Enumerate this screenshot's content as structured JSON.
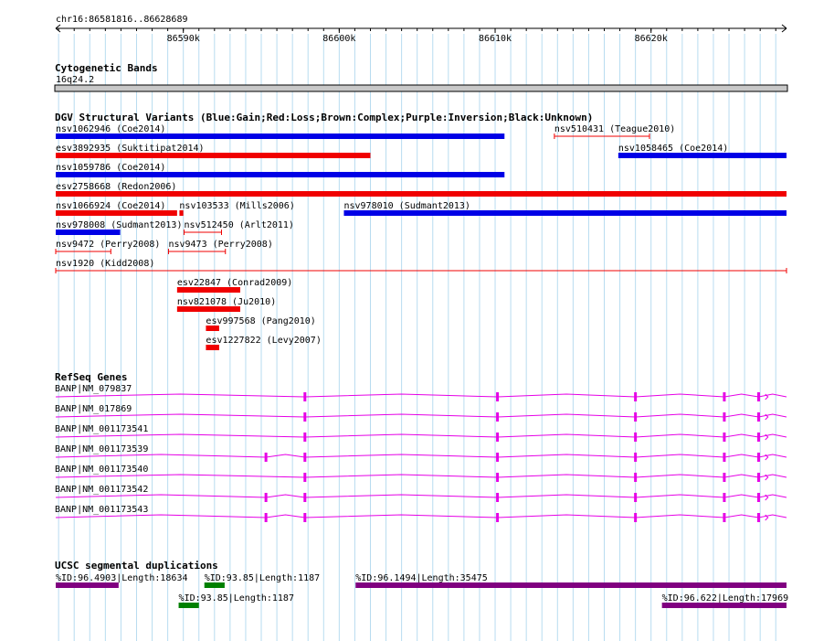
{
  "ruler": {
    "position": "chr16:86581816..86628689",
    "start": 86581816,
    "end": 86628689,
    "ticks": [
      {
        "bp": 86590000,
        "label": "86590k"
      },
      {
        "bp": 86600000,
        "label": "86600k"
      },
      {
        "bp": 86610000,
        "label": "86610k"
      },
      {
        "bp": 86620000,
        "label": "86620k"
      }
    ]
  },
  "cytoband": {
    "title": "Cytogenetic Bands",
    "band": "16q24.2",
    "color": "#c8c8c8"
  },
  "dgv": {
    "title": "DGV Structural Variants (Blue:Gain;Red:Loss;Brown:Complex;Purple:Inversion;Black:Unknown)",
    "colors": {
      "gain": "#0000e6",
      "loss": "#f00000"
    },
    "features": [
      {
        "name": "nsv1062946 (Coe2014)",
        "type": "gain",
        "style": "thick",
        "start": 86581816,
        "end": 86610600,
        "row": 0
      },
      {
        "name": "nsv510431 (Teague2010)",
        "type": "loss",
        "style": "thin",
        "start": 86613800,
        "end": 86619900,
        "row": 0
      },
      {
        "name": "esv3892935 (Suktitipat2014)",
        "type": "loss",
        "style": "thick",
        "start": 86581816,
        "end": 86602000,
        "row": 1
      },
      {
        "name": "nsv1058465 (Coe2014)",
        "type": "gain",
        "style": "thick",
        "start": 86617900,
        "end": 86628689,
        "row": 1
      },
      {
        "name": "nsv1059786 (Coe2014)",
        "type": "gain",
        "style": "thick",
        "start": 86581816,
        "end": 86610600,
        "row": 2
      },
      {
        "name": "esv2758668 (Redon2006)",
        "type": "loss",
        "style": "thick",
        "start": 86581816,
        "end": 86628689,
        "row": 3
      },
      {
        "name": "nsv1066924 (Coe2014)",
        "type": "loss",
        "style": "thick",
        "start": 86581816,
        "end": 86589600,
        "row": 4
      },
      {
        "name": "nsv103533 (Mills2006)",
        "type": "loss",
        "style": "thick",
        "start": 86589750,
        "end": 86590000,
        "row": 4
      },
      {
        "name": "nsv978010 (Sudmant2013)",
        "type": "gain",
        "style": "thick",
        "start": 86600300,
        "end": 86628689,
        "row": 4
      },
      {
        "name": "nsv978008 (Sudmant2013)",
        "type": "gain",
        "style": "thick",
        "start": 86581816,
        "end": 86585950,
        "row": 5
      },
      {
        "name": "nsv512450 (Arlt2011)",
        "type": "loss",
        "style": "thin",
        "start": 86590050,
        "end": 86592450,
        "row": 5
      },
      {
        "name": "nsv9472 (Perry2008)",
        "type": "loss",
        "style": "thin",
        "start": 86581816,
        "end": 86585350,
        "row": 6
      },
      {
        "name": "nsv9473 (Perry2008)",
        "type": "loss",
        "style": "thin",
        "start": 86589050,
        "end": 86592700,
        "row": 6
      },
      {
        "name": "nsv1920 (Kidd2008)",
        "type": "loss",
        "style": "thin",
        "start": 86581816,
        "end": 86628689,
        "row": 7
      },
      {
        "name": "esv22847 (Conrad2009)",
        "type": "loss",
        "style": "thick",
        "start": 86589600,
        "end": 86593650,
        "row": 8
      },
      {
        "name": "nsv821078 (Ju2010)",
        "type": "loss",
        "style": "thick",
        "start": 86589600,
        "end": 86593650,
        "row": 9
      },
      {
        "name": "esv997568 (Pang2010)",
        "type": "loss",
        "style": "thick",
        "start": 86591450,
        "end": 86592300,
        "row": 10
      },
      {
        "name": "esv1227822 (Levy2007)",
        "type": "loss",
        "style": "thick",
        "start": 86591450,
        "end": 86592300,
        "row": 11
      }
    ]
  },
  "refseq": {
    "title": "RefSeq Genes",
    "color": "#e600e6",
    "transcripts": [
      {
        "name": "BANP|NM_079837",
        "exons": [
          86597800,
          86610150,
          86619000,
          86624700,
          86626900
        ],
        "extra_exon": null
      },
      {
        "name": "BANP|NM_017869",
        "exons": [
          86597800,
          86610150,
          86619000,
          86624700,
          86626900
        ],
        "extra_exon": null
      },
      {
        "name": "BANP|NM_001173541",
        "exons": [
          86597800,
          86610150,
          86619000,
          86624700,
          86626900
        ],
        "extra_exon": null
      },
      {
        "name": "BANP|NM_001173539",
        "exons": [
          86597800,
          86610150,
          86619000,
          86624700,
          86626900
        ],
        "extra_exon": 86595300
      },
      {
        "name": "BANP|NM_001173540",
        "exons": [
          86597800,
          86610150,
          86619000,
          86624700,
          86626900
        ],
        "extra_exon": null
      },
      {
        "name": "BANP|NM_001173542",
        "exons": [
          86597800,
          86610150,
          86619000,
          86624700,
          86626900
        ],
        "extra_exon": 86595300
      },
      {
        "name": "BANP|NM_001173543",
        "exons": [
          86597800,
          86610150,
          86619000,
          86624700,
          86626900
        ],
        "extra_exon": 86595300
      }
    ]
  },
  "segdups": {
    "title": "UCSC segmental duplications",
    "features": [
      {
        "name": "%ID:96.4903|Length:18634",
        "color": "#800080",
        "start": 86581816,
        "end": 86585850,
        "row": 0
      },
      {
        "name": "%ID:93.85|Length:1187",
        "color": "#008000",
        "start": 86591350,
        "end": 86592650,
        "row": 0
      },
      {
        "name": "%ID:96.1494|Length:35475",
        "color": "#800080",
        "start": 86601050,
        "end": 86628689,
        "row": 0
      },
      {
        "name": "%ID:93.85|Length:1187",
        "color": "#008000",
        "start": 86589700,
        "end": 86591000,
        "row": 1
      },
      {
        "name": "%ID:96.622|Length:17969",
        "color": "#800080",
        "start": 86620700,
        "end": 86628689,
        "row": 1
      }
    ]
  }
}
